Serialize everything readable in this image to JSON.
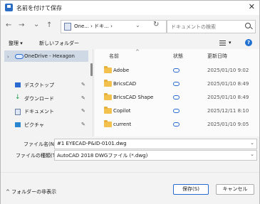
{
  "window": {
    "title": "名前を付けて保存"
  },
  "nav": {
    "back": "←",
    "forward": "→",
    "recent": "⌄",
    "up": "↑",
    "address": "One... › ドキ... ›",
    "refresh": "↻",
    "search_placeholder": "ドキュメントの検索"
  },
  "toolbar": {
    "organize": "整理 ▾",
    "new_folder": "新しいフォルダー",
    "view_caret": "▾"
  },
  "sidebar": {
    "items": [
      {
        "label": "OneDrive - Hexagon",
        "icon": "onedrive-cloud-icon",
        "selected": true
      },
      {
        "label": "デスクトップ",
        "icon": "desktop-icon",
        "pinned": true
      },
      {
        "label": "ダウンロード",
        "icon": "download-icon",
        "pinned": true
      },
      {
        "label": "ドキュメント",
        "icon": "document-icon",
        "pinned": true
      },
      {
        "label": "ピクチャ",
        "icon": "pictures-icon",
        "pinned": true
      }
    ]
  },
  "columns": {
    "name": "名前",
    "status": "状態",
    "date": "更新日時"
  },
  "files": [
    {
      "name": "Adobe",
      "date": "2025/01/10 9:02"
    },
    {
      "name": "BricsCAD",
      "date": "2025/01/10 8:49"
    },
    {
      "name": "BricsCAD Shape",
      "date": "2025/01/10 8:49"
    },
    {
      "name": "Copilot",
      "date": "2025/12/11 8:10"
    },
    {
      "name": "current",
      "date": "2025/01/10 9:05"
    }
  ],
  "form": {
    "filename_label": "ファイル名(N):",
    "filename_value": "#1 EYECAD-P&ID-0101.dwg",
    "filetype_label": "ファイルの種類(T):",
    "filetype_value": "AutoCAD 2018 DWGファイル (*.dwg)"
  },
  "footer": {
    "hide_folders": "^ フォルダーの非表示",
    "save": "保存(S)",
    "cancel": "キャンセル"
  },
  "colors": {
    "accent": "#2a6ad1",
    "folder": "#f2c14e",
    "selection": "#cfd9e6"
  }
}
